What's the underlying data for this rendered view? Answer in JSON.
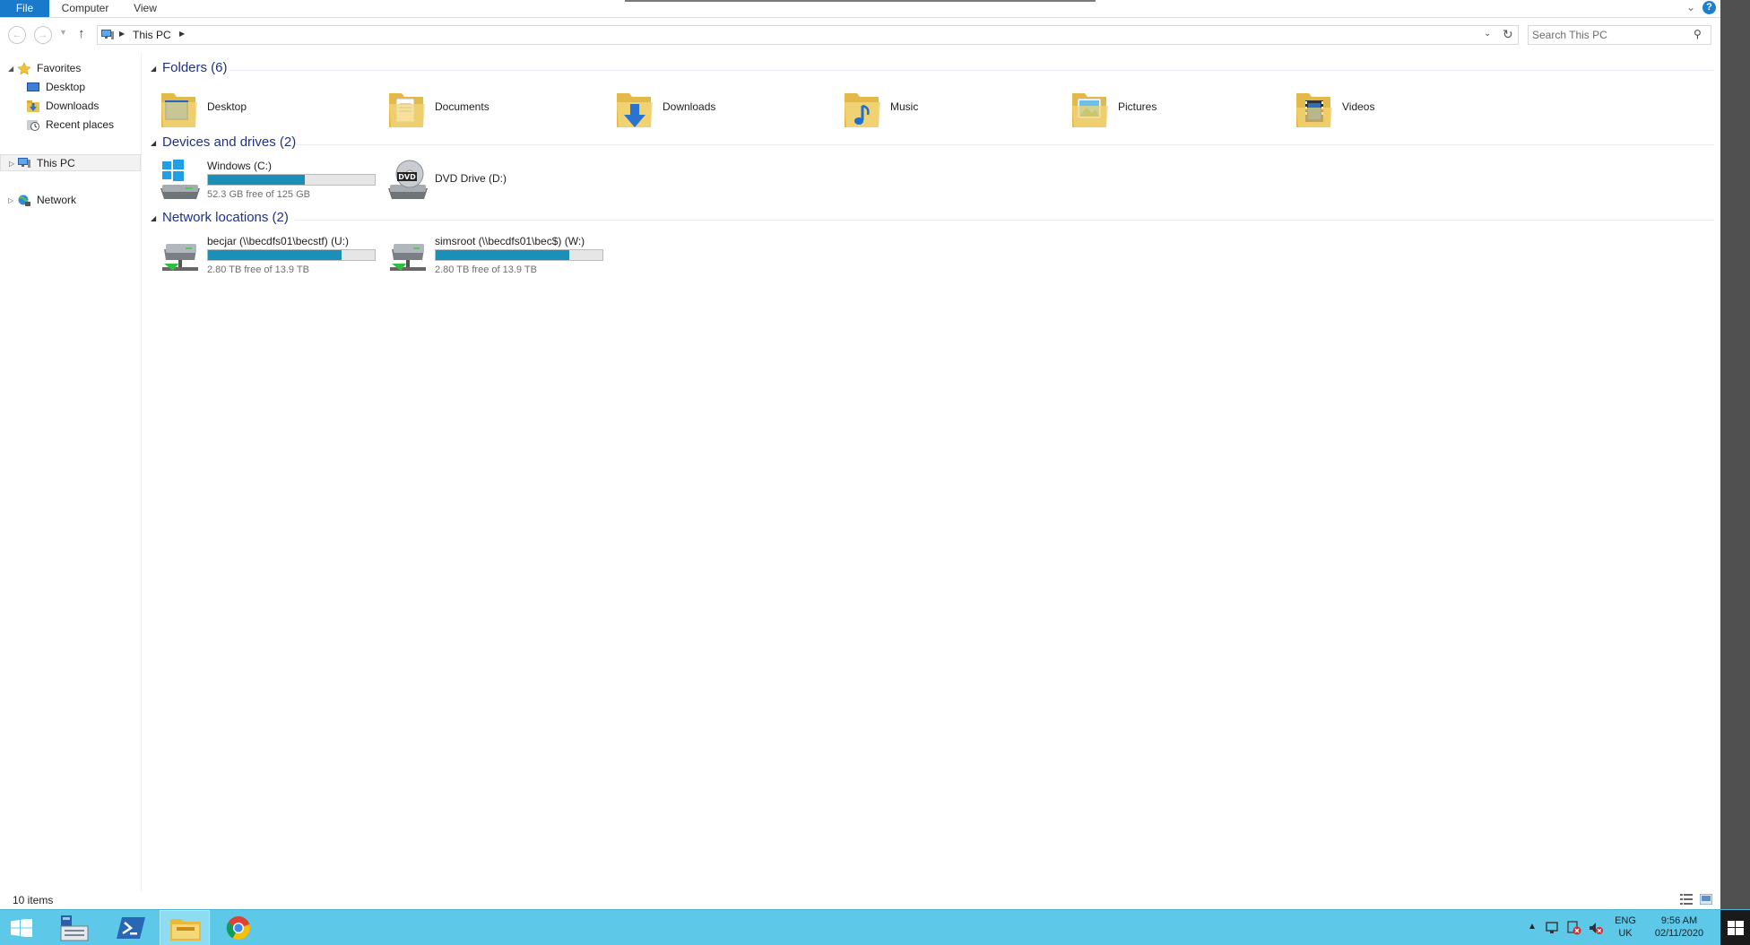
{
  "ribbon": {
    "tabs": [
      {
        "label": "File",
        "active": true
      },
      {
        "label": "Computer"
      },
      {
        "label": "View"
      }
    ],
    "help_label": "?"
  },
  "address": {
    "location": "This PC",
    "search_placeholder": "Search This PC"
  },
  "nav_pane": {
    "items": [
      {
        "label": "Favorites",
        "icon": "star-icon",
        "level": 0,
        "expanded": true
      },
      {
        "label": "Desktop",
        "icon": "desktop-icon",
        "level": 1
      },
      {
        "label": "Downloads",
        "icon": "downloads-folder-icon",
        "level": 1
      },
      {
        "label": "Recent places",
        "icon": "recent-places-icon",
        "level": 1
      },
      {
        "label": "This PC",
        "icon": "computer-icon",
        "level": 0,
        "expanded": false,
        "selected": true
      },
      {
        "label": "Network",
        "icon": "network-icon",
        "level": 0,
        "expanded": false
      }
    ]
  },
  "groups": {
    "folders": {
      "title": "Folders (6)",
      "items": [
        {
          "label": "Desktop",
          "icon": "desktop-folder-icon"
        },
        {
          "label": "Documents",
          "icon": "documents-folder-icon"
        },
        {
          "label": "Downloads",
          "icon": "downloads-folder-icon"
        },
        {
          "label": "Music",
          "icon": "music-folder-icon"
        },
        {
          "label": "Pictures",
          "icon": "pictures-folder-icon"
        },
        {
          "label": "Videos",
          "icon": "videos-folder-icon"
        }
      ]
    },
    "devices": {
      "title": "Devices and drives (2)",
      "items": [
        {
          "label": "Windows (C:)",
          "icon": "windows-drive-icon",
          "free_text": "52.3 GB free of 125 GB",
          "used_fraction": 0.58
        },
        {
          "label": "DVD Drive (D:)",
          "icon": "dvd-drive-icon"
        }
      ]
    },
    "network": {
      "title": "Network locations (2)",
      "items": [
        {
          "label": "becjar (\\\\becdfs01\\becstf) (U:)",
          "icon": "network-drive-icon",
          "free_text": "2.80 TB free of 13.9 TB",
          "used_fraction": 0.8
        },
        {
          "label": "simsroot (\\\\becdfs01\\bec$) (W:)",
          "icon": "network-drive-icon",
          "free_text": "2.80 TB free of 13.9 TB",
          "used_fraction": 0.8
        }
      ]
    }
  },
  "status": {
    "item_count": "10 items"
  },
  "taskbar": {
    "apps": [
      {
        "name": "start-button"
      },
      {
        "name": "server-manager-icon"
      },
      {
        "name": "powershell-icon"
      },
      {
        "name": "file-explorer-icon",
        "active": true
      },
      {
        "name": "chrome-icon"
      }
    ],
    "lang_line1": "ENG",
    "lang_line2": "UK",
    "time": "9:56 AM",
    "date": "02/11/2020"
  },
  "colors": {
    "accent": "#1979ca",
    "group_title": "#1e3287",
    "drive_bar": "#1a8fb8",
    "taskbar": "#5ec8e8"
  }
}
